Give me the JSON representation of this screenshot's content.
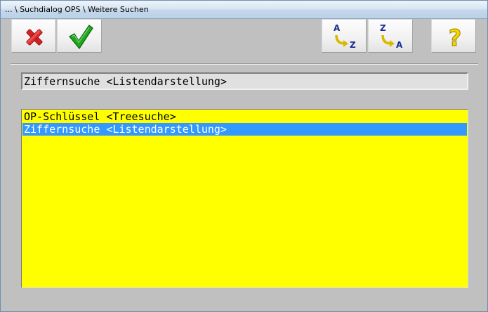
{
  "window": {
    "title": "... \\ Suchdialog OPS \\ Weitere Suchen"
  },
  "toolbar": {
    "buttons": [
      {
        "name": "cancel",
        "icon": "red-x-icon"
      },
      {
        "name": "ok",
        "icon": "green-check-icon"
      },
      {
        "name": "sort-ascending",
        "icon": "sort-a-z-icon",
        "from": "A",
        "to": "Z"
      },
      {
        "name": "sort-descending",
        "icon": "sort-z-a-icon",
        "from": "Z",
        "to": "A"
      },
      {
        "name": "help",
        "icon": "question-mark-icon",
        "glyph": "?"
      }
    ]
  },
  "selected_search": {
    "value": "Ziffernsuche <Listendarstellung>"
  },
  "search_list": {
    "items": [
      {
        "label": "OP-Schlüssel <Treesuche>",
        "selected": false
      },
      {
        "label": "Ziffernsuche <Listendarstellung>",
        "selected": true
      }
    ]
  },
  "colors": {
    "list_background": "#ffff00",
    "selection": "#3399ff",
    "window_background": "#c0c0c0"
  }
}
